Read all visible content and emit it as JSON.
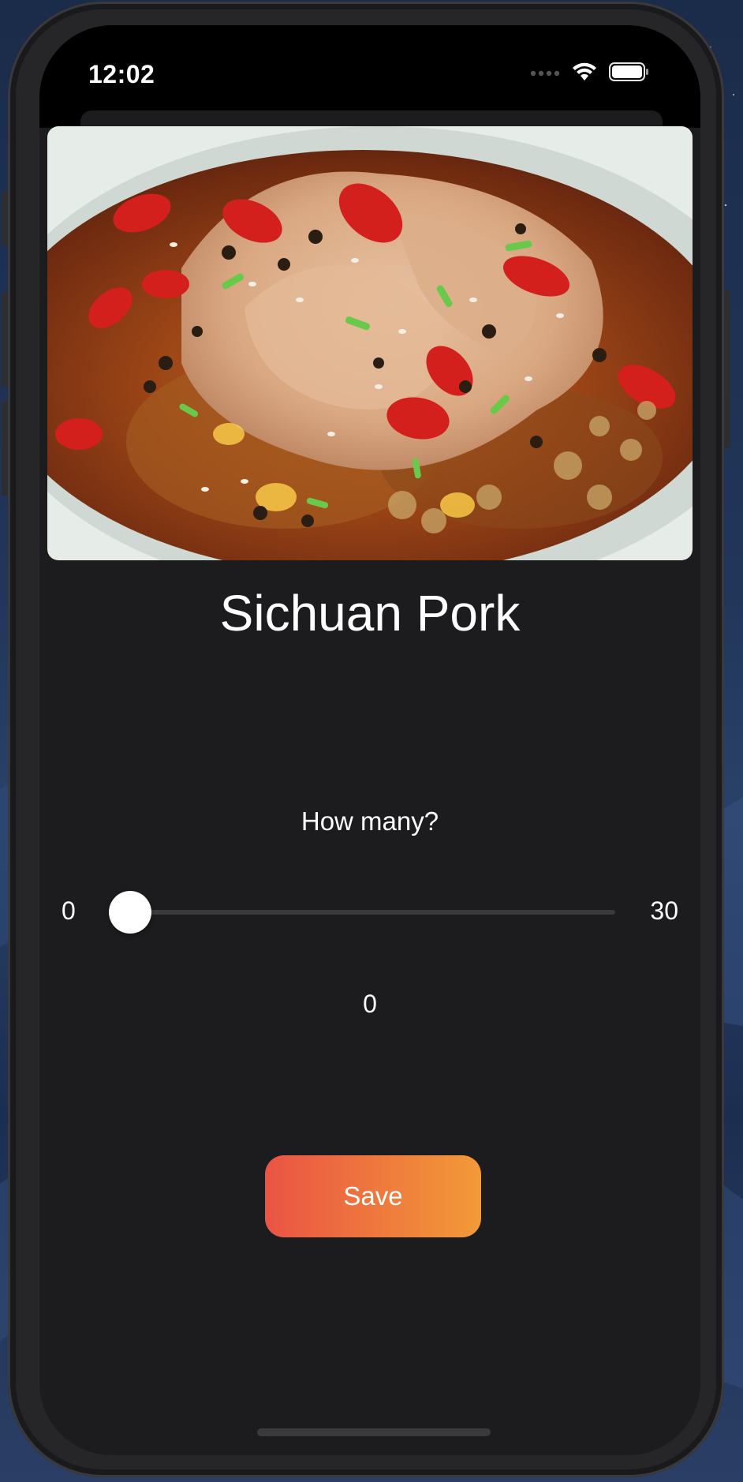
{
  "status_bar": {
    "time": "12:02",
    "icons": [
      "cellular-dots-icon",
      "wifi-icon",
      "battery-icon"
    ]
  },
  "dish": {
    "image_alt": "Sichuan Pork",
    "title": "Sichuan Pork"
  },
  "quantity": {
    "prompt": "How many?",
    "min_label": "0",
    "max_label": "30",
    "min": 0,
    "max": 30,
    "value": 0,
    "value_label": "0"
  },
  "actions": {
    "save_label": "Save"
  },
  "colors": {
    "background": "#1c1c1e",
    "save_gradient_start": "#ea5444",
    "save_gradient_end": "#f29a38",
    "slider_track": "#3a3a3c",
    "slider_thumb": "#ffffff"
  }
}
